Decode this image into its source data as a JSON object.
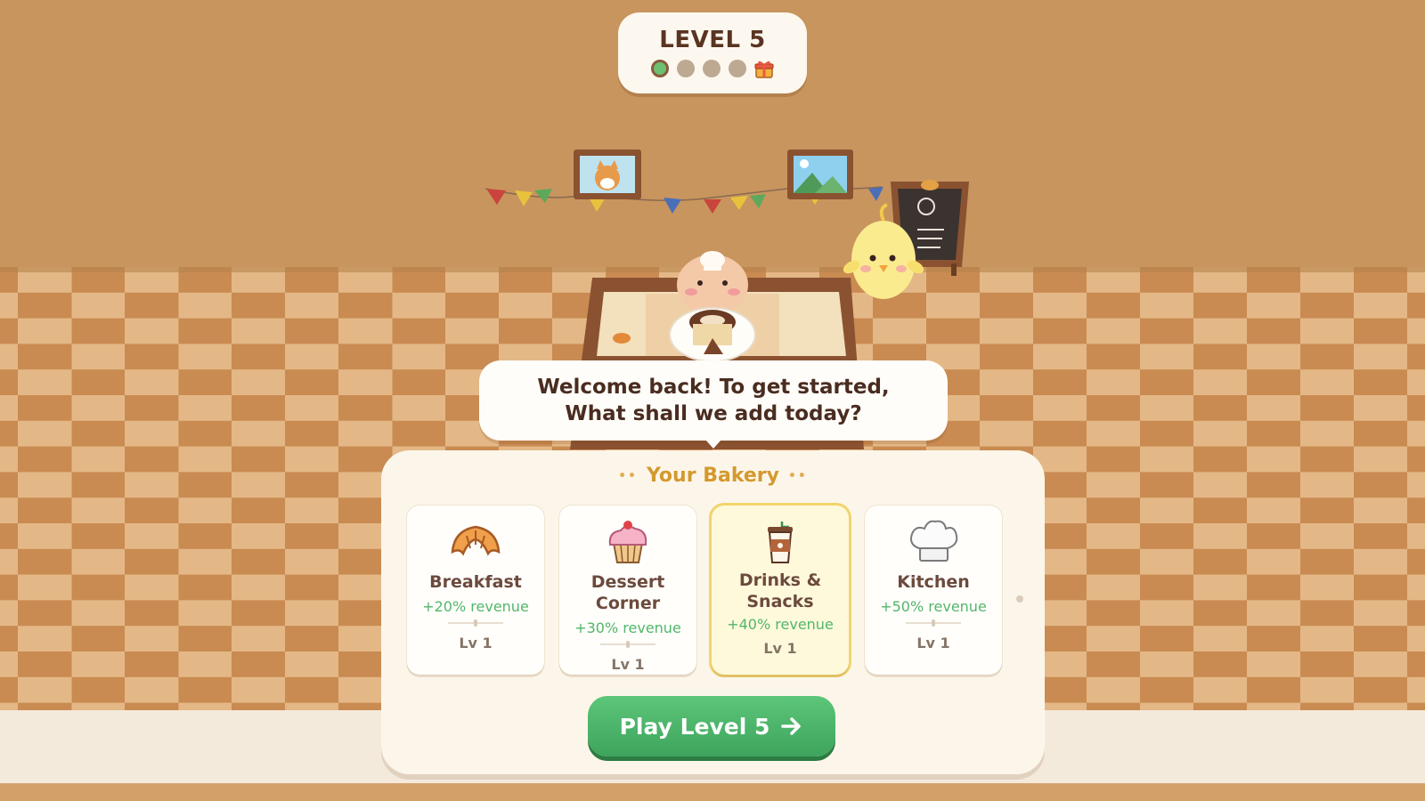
{
  "level": {
    "title": "LEVEL 5",
    "progress": {
      "completed": 1,
      "total_dots": 4,
      "reward_icon": "gift-icon"
    }
  },
  "dialog": {
    "message": "Welcome back! To get started, What shall we add today?"
  },
  "bakery": {
    "title": "Your Bakery",
    "cards": [
      {
        "name": "Breakfast",
        "revenue": "+20% revenue",
        "level": "Lv 1",
        "icon": "croissant-icon",
        "selected": false
      },
      {
        "name": "Dessert Corner",
        "revenue": "+30% revenue",
        "level": "Lv 1",
        "icon": "cupcake-icon",
        "selected": false
      },
      {
        "name": "Drinks & Snacks",
        "revenue": "+40% revenue",
        "level": "Lv 1",
        "icon": "coffee-cup-icon",
        "selected": true
      },
      {
        "name": "Kitchen",
        "revenue": "+50% revenue",
        "level": "Lv 1",
        "icon": "chef-hat-icon",
        "selected": false
      }
    ]
  },
  "play_button": {
    "label": "Play Level 5",
    "icon": "arrow-right-icon"
  },
  "colors": {
    "wall": "#c8955e",
    "floor_light": "#e4b886",
    "floor_dark": "#c98b52",
    "accent_gold": "#d4992e",
    "revenue_green": "#52b66a",
    "button_green": "#4db46b"
  }
}
